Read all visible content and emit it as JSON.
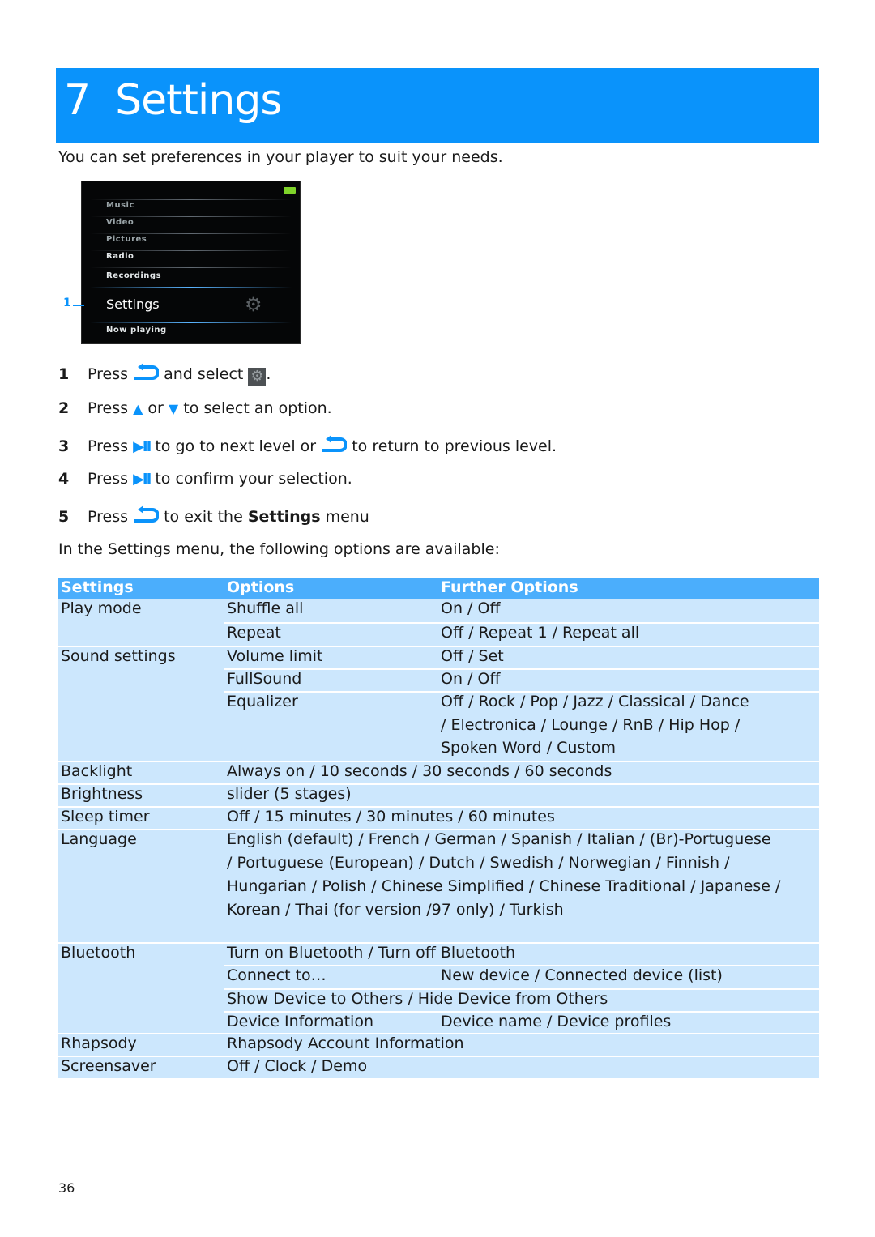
{
  "header": {
    "chapter": "7",
    "title": "Settings"
  },
  "intro": "You can set preferences in your player to suit your needs.",
  "device_screen": {
    "menu_items": [
      "Music",
      "Video",
      "Pictures",
      "Radio",
      "Recordings"
    ],
    "selected_item": "Settings",
    "bottom_item": "Now playing",
    "callout": "1",
    "battery_color": "#7fd32a"
  },
  "steps": [
    {
      "num": "1",
      "parts": [
        "Press",
        "and select",
        "."
      ]
    },
    {
      "num": "2",
      "parts": [
        "Press",
        "or",
        "to select an option."
      ]
    },
    {
      "num": "3",
      "parts": [
        "Press",
        "to go to next level or",
        "to return to previous level."
      ]
    },
    {
      "num": "4",
      "parts": [
        "Press",
        "to confirm your selection."
      ]
    },
    {
      "num": "5",
      "parts": [
        "Press",
        "to exit the",
        "Settings",
        "menu"
      ]
    }
  ],
  "icons": {
    "back": "back-arrow-icon",
    "settings": "gear-icon",
    "up": "▲",
    "down": "▼",
    "play_pause": "▶II"
  },
  "available_text": "In the Settings menu, the following options are available:",
  "table": {
    "headers": [
      "Settings",
      "Options",
      "Further Options"
    ],
    "rows": [
      {
        "setting": "Play mode",
        "option": "Shuffle all",
        "further": "On / Off"
      },
      {
        "setting": "",
        "option": "Repeat",
        "further": "Off / Repeat 1 / Repeat all"
      },
      {
        "setting": "Sound settings",
        "option": "Volume limit",
        "further": "Off / Set"
      },
      {
        "setting": "",
        "option": "FullSound",
        "further": "On / Off"
      },
      {
        "setting": "",
        "option": "Equalizer",
        "further": "Off / Rock / Pop / Jazz / Classical / Dance",
        "further2": "/ Electronica / Lounge / RnB / Hip Hop /",
        "further3": "Spoken Word / Custom"
      },
      {
        "setting": "Backlight",
        "option": "Always on / 10 seconds / 30 seconds / 60 seconds"
      },
      {
        "setting": "Brightness",
        "option": "slider (5 stages)"
      },
      {
        "setting": "Sleep timer",
        "option": "Off / 15 minutes / 30 minutes / 60 minutes"
      },
      {
        "setting": "Language",
        "option": "English (default) / French / German / Spanish / Italian / (Br)-Portuguese",
        "option2": "/ Portuguese (European) / Dutch / Swedish / Norwegian / Finnish /",
        "option3": "Hungarian / Polish / Chinese Simplified / Chinese Traditional / Japanese /",
        "option4": "Korean / Thai (for version /97 only) / Turkish"
      },
      {
        "setting": "Bluetooth",
        "option": "Turn on Bluetooth / Turn off Bluetooth"
      },
      {
        "setting": "",
        "option": "Connect to…",
        "further": "New device / Connected device (list)"
      },
      {
        "setting": "",
        "option": "Show Device to Others / Hide Device from Others"
      },
      {
        "setting": "",
        "option": "Device Information",
        "further": "Device name / Device profiles"
      },
      {
        "setting": "Rhapsody",
        "option": "Rhapsody Account Information"
      },
      {
        "setting": "Screensaver",
        "option": "Off / Clock / Demo"
      }
    ]
  },
  "colors": {
    "accent": "#0a93fb",
    "table_header": "#4baefc",
    "table_row": "#cce7fd"
  },
  "page_number": "36"
}
